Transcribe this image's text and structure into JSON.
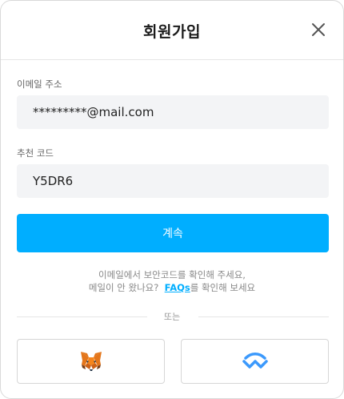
{
  "header": {
    "title": "회원가입"
  },
  "form": {
    "email_label": "이메일 주소",
    "email_value": "*********@mail.com",
    "referral_label": "추천 코드",
    "referral_value": "Y5DR6"
  },
  "actions": {
    "continue_label": "계속"
  },
  "help": {
    "line1": "이메일에서 보안코드를 확인해 주세요,",
    "line2_prefix": "메일이 안 왔나요?",
    "faq_link": "FAQs",
    "line2_suffix": "를 확인해 보세요"
  },
  "divider": {
    "or_label": "또는"
  },
  "wallets": [
    {
      "icon": "metamask-fox-icon"
    },
    {
      "icon": "walletconnect-icon"
    }
  ],
  "colors": {
    "accent": "#00aeff",
    "field_bg": "#f3f4f6"
  }
}
